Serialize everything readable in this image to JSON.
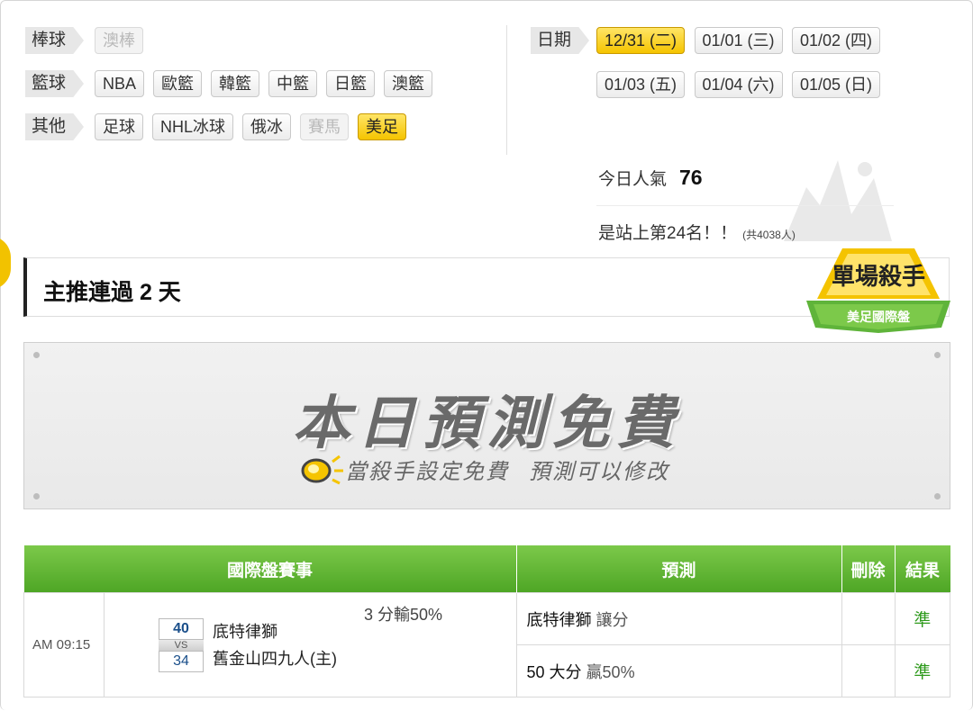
{
  "categories": [
    {
      "label": "棒球",
      "items": [
        {
          "text": "澳棒",
          "state": "disabled"
        }
      ]
    },
    {
      "label": "籃球",
      "items": [
        {
          "text": "NBA",
          "state": "normal"
        },
        {
          "text": "歐籃",
          "state": "normal"
        },
        {
          "text": "韓籃",
          "state": "normal"
        },
        {
          "text": "中籃",
          "state": "normal"
        },
        {
          "text": "日籃",
          "state": "normal"
        },
        {
          "text": "澳籃",
          "state": "normal"
        }
      ]
    },
    {
      "label": "其他",
      "items": [
        {
          "text": "足球",
          "state": "normal"
        },
        {
          "text": "NHL冰球",
          "state": "normal"
        },
        {
          "text": "俄冰",
          "state": "normal"
        },
        {
          "text": "賽馬",
          "state": "disabled"
        },
        {
          "text": "美足",
          "state": "active"
        }
      ]
    }
  ],
  "dates": {
    "label": "日期",
    "items": [
      {
        "text": "12/31 (二)",
        "active": true
      },
      {
        "text": "01/01 (三)",
        "active": false
      },
      {
        "text": "01/02 (四)",
        "active": false
      },
      {
        "text": "01/03 (五)",
        "active": false
      },
      {
        "text": "01/04 (六)",
        "active": false
      },
      {
        "text": "01/05 (日)",
        "active": false
      }
    ]
  },
  "stats": {
    "popularity_label": "今日人氣",
    "popularity_value": "76",
    "rank_text": "是站上第24名！！",
    "total_text": "(共4038人)"
  },
  "headline": {
    "text": "主推連過 2 天"
  },
  "badge": {
    "title": "單場殺手",
    "subtitle": "美足國際盤"
  },
  "banner": {
    "title": "本日預測免費",
    "sub_left": "當殺手設定免費",
    "sub_right": "預測可以修改"
  },
  "table": {
    "headers": {
      "event": "國際盤賽事",
      "prediction": "預測",
      "delete": "刪除",
      "result": "結果"
    },
    "game": {
      "time": "AM 09:15",
      "away_score": "40",
      "home_score": "34",
      "vs": "VS",
      "away_team": "底特律獅",
      "home_team": "舊金山四九人(主)",
      "line": "3 分輸50%",
      "picks": [
        {
          "main": "底特律獅",
          "detail": "讓分",
          "result": "準"
        },
        {
          "main": "50 大分",
          "detail": "贏50%",
          "result": "準"
        }
      ]
    }
  },
  "colors": {
    "accent_green": "#4ea625",
    "active_yellow": "#f5c400",
    "result_green": "#2e9a1c"
  }
}
